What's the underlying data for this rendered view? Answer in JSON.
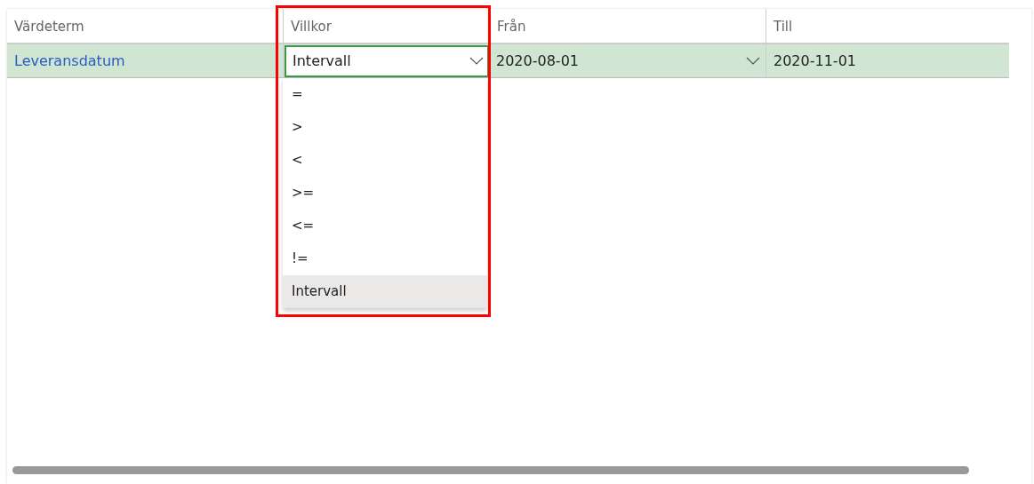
{
  "table": {
    "columns": [
      {
        "label": "Värdeterm",
        "highlighted": false
      },
      {
        "label": "Villkor",
        "highlighted": true
      },
      {
        "label": "Från",
        "highlighted": false
      },
      {
        "label": "Till",
        "highlighted": false
      }
    ],
    "rows": [
      {
        "selected": true,
        "term": "Leveransdatum",
        "condition": "Intervall",
        "from": "2020-08-01",
        "to": "2020-11-01"
      }
    ]
  },
  "dropdown": {
    "expanded": true,
    "options": [
      {
        "label": "=",
        "selected": false
      },
      {
        "label": ">",
        "selected": false
      },
      {
        "label": "<",
        "selected": false
      },
      {
        "label": ">=",
        "selected": false
      },
      {
        "label": "<=",
        "selected": false
      },
      {
        "label": "!=",
        "selected": false
      },
      {
        "label": "Intervall",
        "selected": true
      }
    ]
  }
}
